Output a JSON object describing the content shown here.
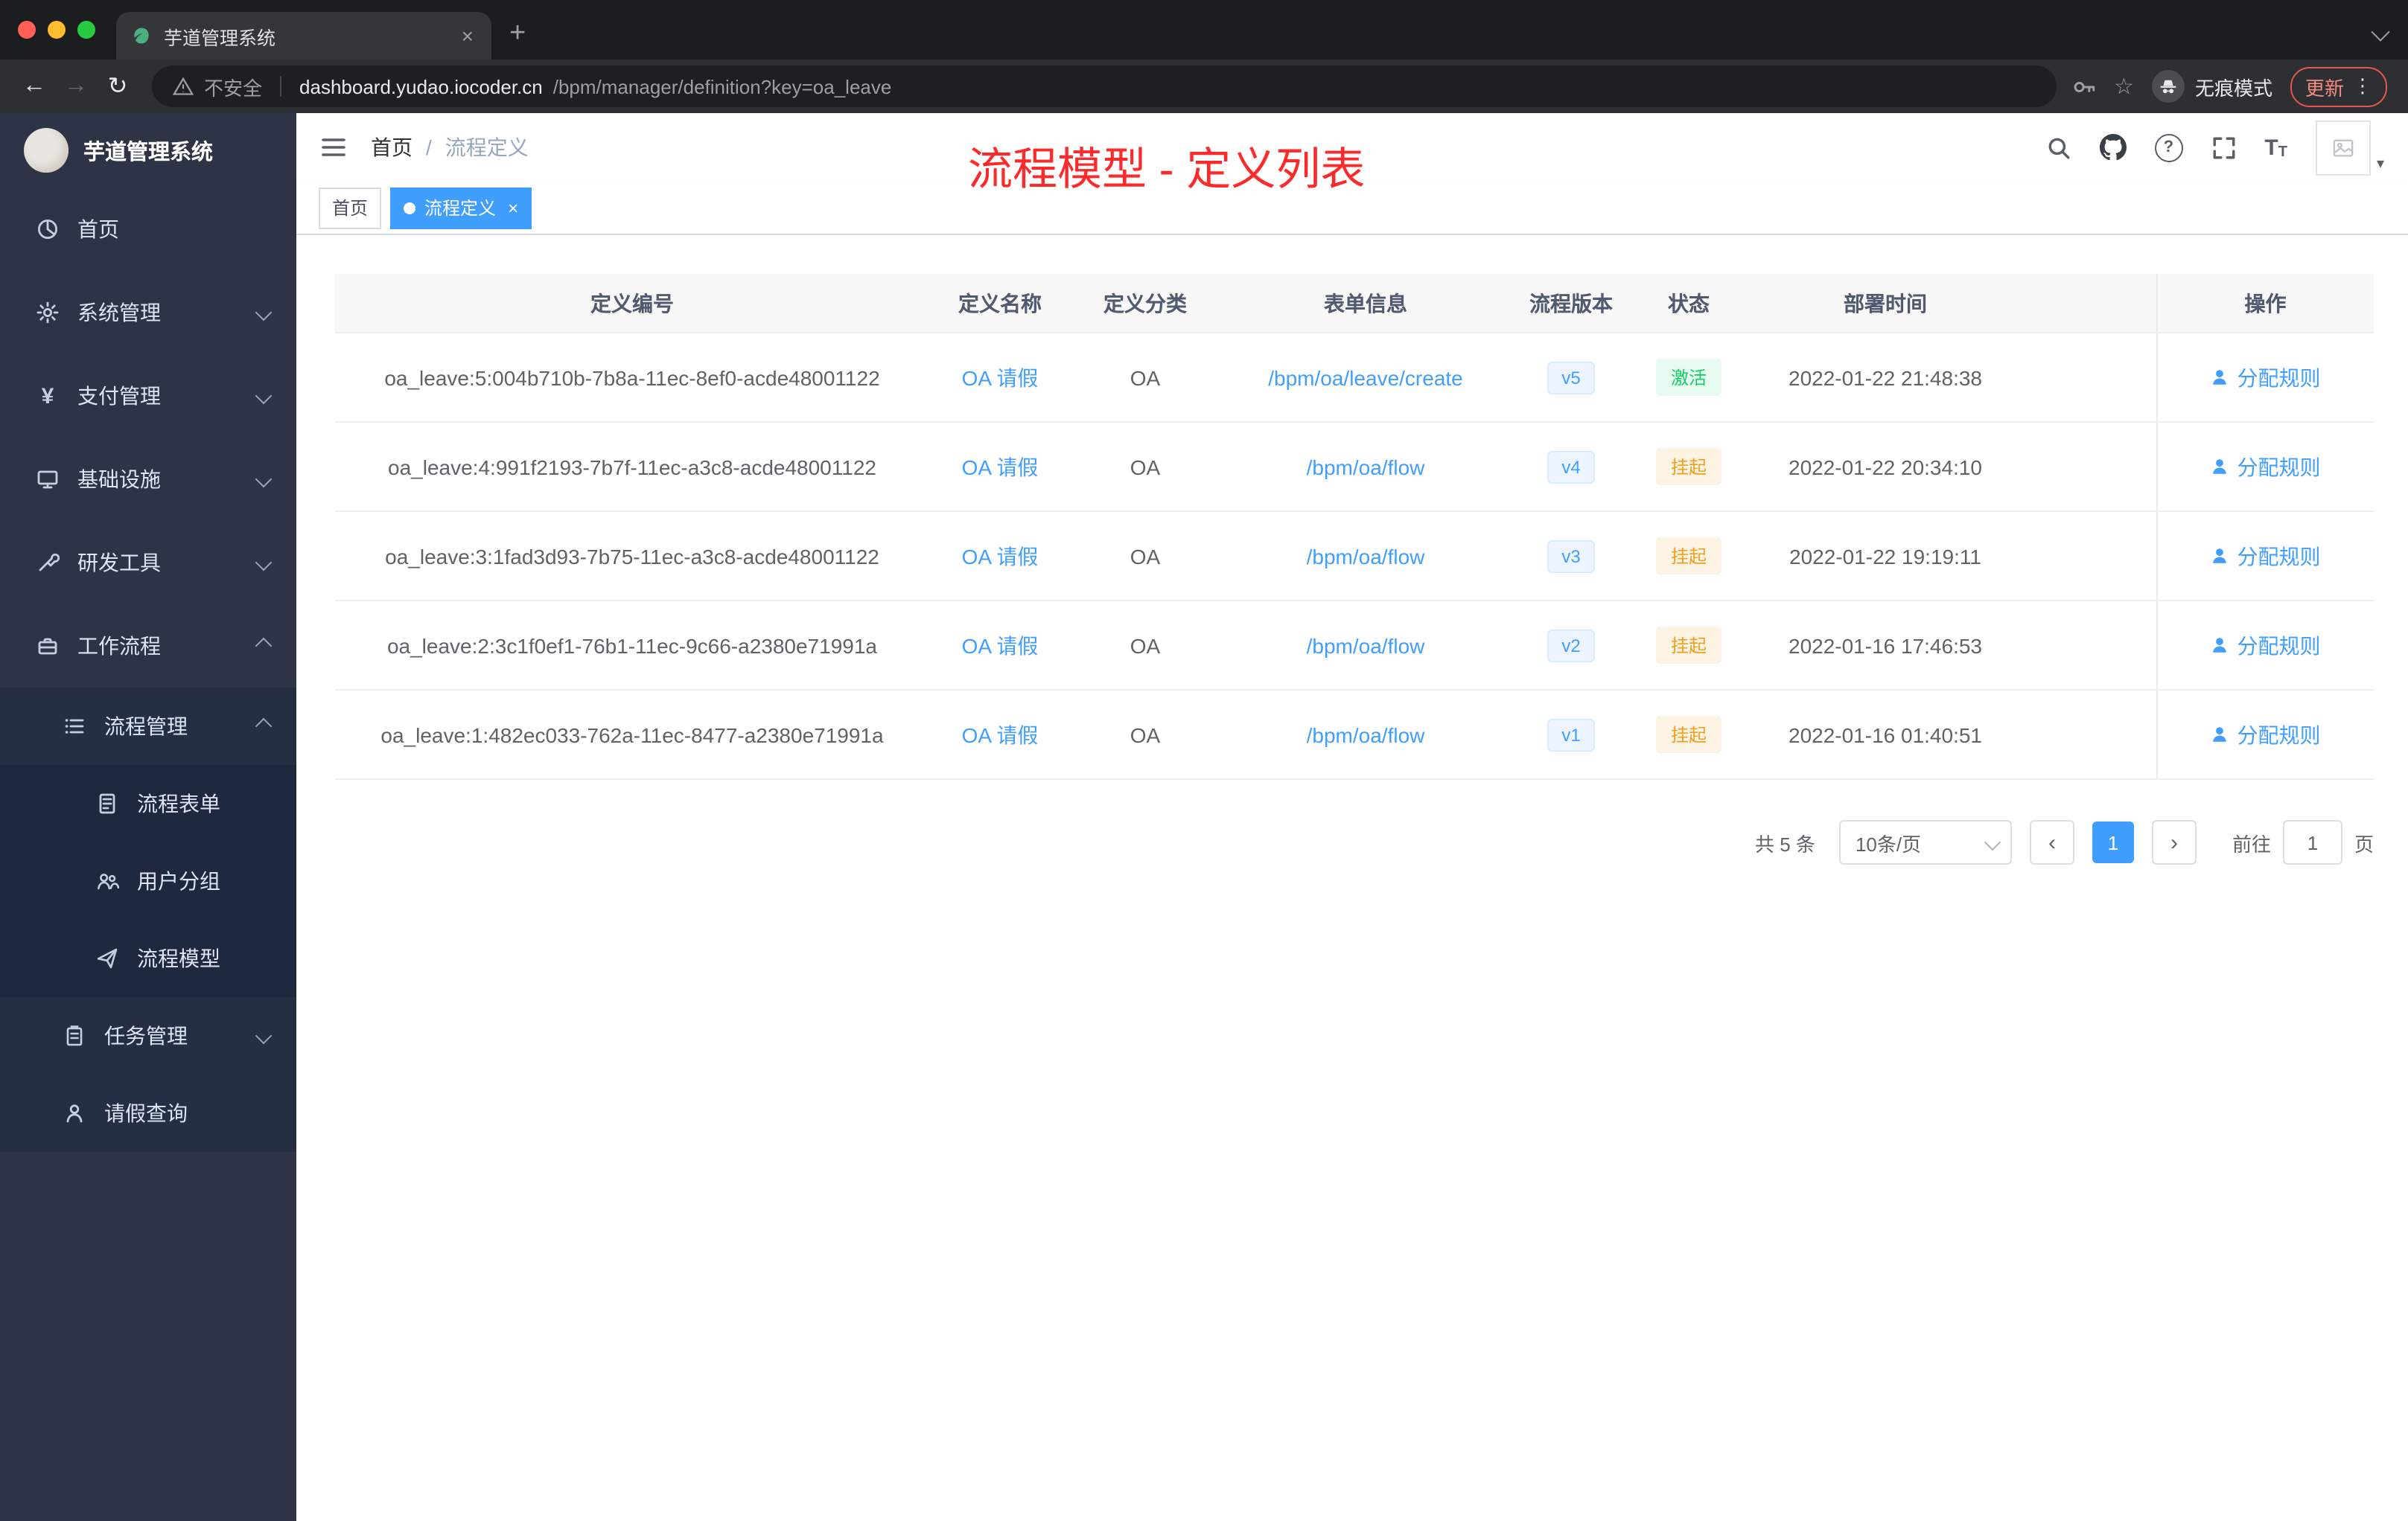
{
  "browser": {
    "tab_title": "芋道管理系统",
    "security_label": "不安全",
    "url_host": "dashboard.yudao.iocoder.cn",
    "url_path": "/bpm/manager/definition?key=oa_leave",
    "incognito_label": "无痕模式",
    "update_label": "更新"
  },
  "glyphs": {
    "back": "←",
    "forward": "→",
    "reload": "↻",
    "star": "☆",
    "kebab": "⋮",
    "plus": "+",
    "close": "×",
    "caret_down": "▾",
    "pager_prev": "‹",
    "pager_next": "›",
    "question": "?",
    "t_big": "T",
    "t_small": "T"
  },
  "sidebar": {
    "logo_title": "芋道管理系统",
    "items": [
      {
        "label": "首页"
      },
      {
        "label": "系统管理"
      },
      {
        "label": "支付管理"
      },
      {
        "label": "基础设施"
      },
      {
        "label": "研发工具"
      },
      {
        "label": "工作流程"
      },
      {
        "label": "流程管理"
      },
      {
        "label": "流程表单"
      },
      {
        "label": "用户分组"
      },
      {
        "label": "流程模型"
      },
      {
        "label": "任务管理"
      },
      {
        "label": "请假查询"
      }
    ]
  },
  "header": {
    "breadcrumb_home": "首页",
    "breadcrumb_sep": "/",
    "breadcrumb_current": "流程定义",
    "annotation": "流程模型 - 定义列表"
  },
  "tags": {
    "home": "首页",
    "active": "流程定义"
  },
  "table": {
    "columns": [
      "定义编号",
      "定义名称",
      "定义分类",
      "表单信息",
      "流程版本",
      "状态",
      "部署时间",
      "操作"
    ],
    "rows": [
      {
        "id": "oa_leave:5:004b710b-7b8a-11ec-8ef0-acde48001122",
        "name": "OA 请假",
        "category": "OA",
        "form": "/bpm/oa/leave/create",
        "version": "v5",
        "status": "激活",
        "time": "2022-01-22 21:48:38",
        "action": "分配规则"
      },
      {
        "id": "oa_leave:4:991f2193-7b7f-11ec-a3c8-acde48001122",
        "name": "OA 请假",
        "category": "OA",
        "form": "/bpm/oa/flow",
        "version": "v4",
        "status": "挂起",
        "time": "2022-01-22 20:34:10",
        "action": "分配规则"
      },
      {
        "id": "oa_leave:3:1fad3d93-7b75-11ec-a3c8-acde48001122",
        "name": "OA 请假",
        "category": "OA",
        "form": "/bpm/oa/flow",
        "version": "v3",
        "status": "挂起",
        "time": "2022-01-22 19:19:11",
        "action": "分配规则"
      },
      {
        "id": "oa_leave:2:3c1f0ef1-76b1-11ec-9c66-a2380e71991a",
        "name": "OA 请假",
        "category": "OA",
        "form": "/bpm/oa/flow",
        "version": "v2",
        "status": "挂起",
        "time": "2022-01-16 17:46:53",
        "action": "分配规则"
      },
      {
        "id": "oa_leave:1:482ec033-762a-11ec-8477-a2380e71991a",
        "name": "OA 请假",
        "category": "OA",
        "form": "/bpm/oa/flow",
        "version": "v1",
        "status": "挂起",
        "time": "2022-01-16 01:40:51",
        "action": "分配规则"
      }
    ]
  },
  "pagination": {
    "total": "共 5 条",
    "page_size": "10条/页",
    "current_page": "1",
    "goto_label": "前往",
    "goto_value": "1",
    "unit": "页"
  },
  "colors": {
    "accent": "#409eff",
    "success": "#13ce66",
    "warning": "#f0a020",
    "annotation_red": "#fb2b2b",
    "sidebar_bg": "#2e3446"
  }
}
